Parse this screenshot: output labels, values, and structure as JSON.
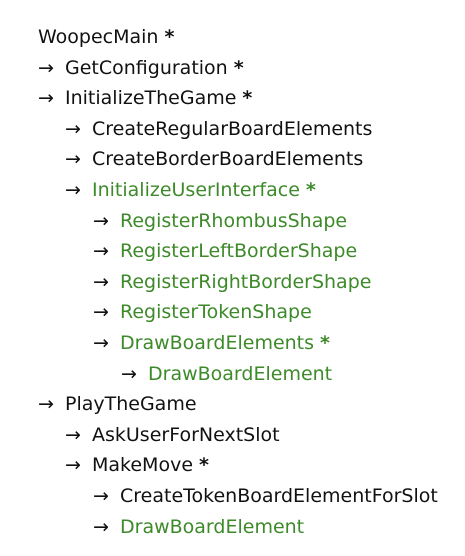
{
  "tree": {
    "arrow_glyph": "→",
    "green_color": "#3d8a2a",
    "text_color": "#111111",
    "rows": [
      {
        "label": "WoopecMain",
        "depth": 0,
        "star": "*",
        "green": false
      },
      {
        "label": "GetConfiguration",
        "depth": 1,
        "star": "*",
        "green": false
      },
      {
        "label": "InitializeTheGame",
        "depth": 1,
        "star": "*",
        "green": false
      },
      {
        "label": "CreateRegularBoardElements",
        "depth": 2,
        "star": "",
        "green": false
      },
      {
        "label": "CreateBorderBoardElements",
        "depth": 2,
        "star": "",
        "green": false
      },
      {
        "label": "InitializeUserInterface",
        "depth": 2,
        "star": "*",
        "green": true
      },
      {
        "label": "RegisterRhombusShape",
        "depth": 3,
        "star": "",
        "green": true
      },
      {
        "label": "RegisterLeftBorderShape",
        "depth": 3,
        "star": "",
        "green": true
      },
      {
        "label": "RegisterRightBorderShape",
        "depth": 3,
        "star": "",
        "green": true
      },
      {
        "label": "RegisterTokenShape",
        "depth": 3,
        "star": "",
        "green": true
      },
      {
        "label": "DrawBoardElements",
        "depth": 3,
        "star": "*",
        "green": true
      },
      {
        "label": "DrawBoardElement",
        "depth": 4,
        "star": "",
        "green": true
      },
      {
        "label": "PlayTheGame",
        "depth": 1,
        "star": "",
        "green": false
      },
      {
        "label": "AskUserForNextSlot",
        "depth": 2,
        "star": "",
        "green": false
      },
      {
        "label": "MakeMove",
        "depth": 2,
        "star": "*",
        "green": false
      },
      {
        "label": "CreateTokenBoardElementForSlot",
        "depth": 3,
        "star": "",
        "green": false
      },
      {
        "label": "DrawBoardElement",
        "depth": 3,
        "star": "",
        "green": true
      }
    ]
  }
}
